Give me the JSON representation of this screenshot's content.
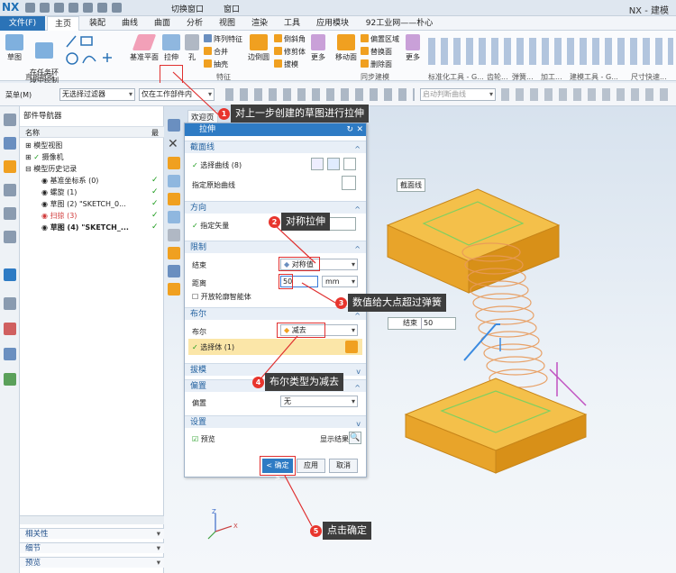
{
  "app": {
    "logo": "NX",
    "title": "NX - 建模",
    "window_tools": [
      "切换窗口",
      "窗口"
    ]
  },
  "tabs": [
    "文件(F)",
    "主页",
    "装配",
    "曲线",
    "曲面",
    "分析",
    "视图",
    "渲染",
    "工具",
    "应用模块",
    "92工业网——朴心"
  ],
  "ribbon": {
    "sketch": "草图",
    "sketch_in_task": "在任务环\n境中绘制",
    "datum_plane": "基准平面",
    "extrude": "拉伸",
    "hole": "孔",
    "pattern": "阵列特征",
    "unite": "合并",
    "shell": "抽壳",
    "edge_blend": "边倒圆",
    "chamfer": "倒斜角",
    "trim_body": "修剪体",
    "draft": "拔模",
    "more": "更多",
    "move_face": "移动面",
    "offset_region": "偏置区域",
    "replace_face": "替换面",
    "delete_face": "删除面",
    "more2": "更多",
    "group_direct_sketch": "直接草图",
    "group_feature": "特征",
    "group_sync": "同步建模",
    "groups_right": [
      "标准化工具 - G...",
      "齿轮...",
      "弹簧...",
      "加工...",
      "建模工具 - G...",
      "尺寸快速..."
    ]
  },
  "filterbar": {
    "menu": "菜单(M)",
    "filter": "无选择过滤器",
    "scope": "仅在工作部件内",
    "snap": "启动判断曲线"
  },
  "navigator": {
    "title": "部件导航器",
    "col_name": "名称",
    "col_latest": "最",
    "rows": [
      "模型视图",
      "摄像机",
      "模型历史记录",
      "基准坐标系 (0)",
      "螺旋 (1)",
      "草图 (2) \"SKETCH_0...",
      "扫掠 (3)",
      "草图 (4) \"SKETCH_..."
    ],
    "bottom": [
      "相关性",
      "细节",
      "预览"
    ]
  },
  "viewport": {
    "tab": "欢迎页",
    "label_section": "截面线",
    "end_label": "结束",
    "end_value": "50"
  },
  "dialog": {
    "title": "拉伸",
    "sec_section": "截面线",
    "select_curve": "选择曲线 (8)",
    "specify_origin": "指定原始曲线",
    "sec_direction": "方向",
    "specify_vector": "指定矢量",
    "sec_limits": "限制",
    "end": "结束",
    "end_value": "对称值",
    "distance": "距离",
    "distance_value": "50",
    "unit": "mm",
    "open_profile": "开放轮廓智能体",
    "sec_boolean": "布尔",
    "boolean": "布尔",
    "boolean_value": "减去",
    "select_body": "选择体 (1)",
    "sec_draft": "拔模",
    "sec_offset": "偏置",
    "offset": "偏置",
    "offset_value": "无",
    "sec_settings": "设置",
    "preview": "预览",
    "show_result": "显示结果",
    "ok": "< 确定 >",
    "apply": "应用",
    "cancel": "取消"
  },
  "callouts": [
    {
      "n": "1",
      "text": "对上一步创建的草图进行拉伸"
    },
    {
      "n": "2",
      "text": "对称拉伸"
    },
    {
      "n": "3",
      "text": "数值给大点超过弹簧"
    },
    {
      "n": "4",
      "text": "布尔类型为减去"
    },
    {
      "n": "5",
      "text": "点击确定"
    }
  ],
  "colors": {
    "accent": "#2b73b7",
    "callout": "#e8352d",
    "box": "#f0a020",
    "spring": "#e89a5a"
  }
}
